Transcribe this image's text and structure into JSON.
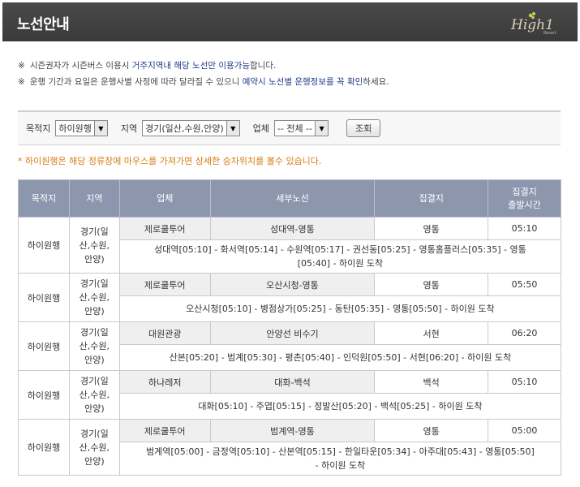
{
  "header": {
    "title": "노선안내",
    "logo_text": "High1"
  },
  "notes": [
    {
      "mark": "※",
      "pre": "시즌권자가 시즌버스 이용시 ",
      "highlight": "거주지역내 해당 노선만 이용가능",
      "post": "합니다."
    },
    {
      "mark": "※",
      "pre": "운행 기간과 요일은 운행사별 사정에 따라 달라질 수 있으니 ",
      "highlight": "예약시 노선별 운행정보를 꼭 확인",
      "post": "하세요."
    }
  ],
  "filter": {
    "destination_label": "목적지",
    "destination_value": "하이원행",
    "region_label": "지역",
    "region_value": "경기(일산,수원,안양)",
    "company_label": "업체",
    "company_value": "-- 전체 --",
    "search_button": "조회"
  },
  "hint": "* 하이원행은 해당 정류장에 마우스를 가져가면 상세한 승차위치를 볼수 있습니다.",
  "table": {
    "headers": {
      "destination": "목적지",
      "region": "지역",
      "company": "업체",
      "route": "세부노선",
      "hub": "집결지",
      "time_line1": "집결지",
      "time_line2": "출발시간"
    },
    "rows": [
      {
        "destination": "하이원행",
        "region": [
          "경기(일",
          "산,수원,",
          "안양)"
        ],
        "company": "제로쿨투어",
        "route": "성대역-영통",
        "hub": "영통",
        "time": "05:10",
        "stops": [
          "성대역[05:10] - 화서역[05:14] - 수원역[05:17] - 권선동[05:25] - 영통홈플러스[05:35] - 영통",
          "[05:40] - 하이원 도착"
        ]
      },
      {
        "destination": "하이원행",
        "region": [
          "경기(일",
          "산,수원,",
          "안양)"
        ],
        "company": "제로쿨투어",
        "route": "오산시청-영통",
        "hub": "영통",
        "time": "05:50",
        "stops": [
          "오산시청[05:10] - 병점상가[05:25] - 동탄[05:35] - 영통[05:50] - 하이원 도착"
        ]
      },
      {
        "destination": "하이원행",
        "region": [
          "경기(일",
          "산,수원,",
          "안양)"
        ],
        "company": "대원관광",
        "route": "안양선 비수기",
        "hub": "서현",
        "time": "06:20",
        "stops": [
          "산본[05:20] - 범계[05:30] - 평촌[05:40] - 인덕원[05:50] - 서현[06:20] - 하이원 도착"
        ]
      },
      {
        "destination": "하이원행",
        "region": [
          "경기(일",
          "산,수원,",
          "안양)"
        ],
        "company": "하나레저",
        "route": "대화-백석",
        "hub": "백석",
        "time": "05:10",
        "stops": [
          "대화[05:10] - 주엽[05:15] - 정발산[05:20] - 백석[05:25] - 하이원 도착"
        ]
      },
      {
        "destination": "하이원행",
        "region": [
          "경기(일",
          "산,수원,",
          "안양)"
        ],
        "company": "제로쿨투어",
        "route": "범계역-영통",
        "hub": "영통",
        "time": "05:00",
        "stops": [
          "범계역[05:00] - 금정역[05:10] - 산본역[05:15] - 한일타운[05:34] - 아주대[05:43] - 영통[05:50]",
          "- 하이원 도착"
        ]
      }
    ]
  },
  "colors": {
    "header_bg": "#3f3f3f",
    "table_header_bg": "#8c97ae",
    "hint": "#d97a12",
    "highlight": "#223c8a"
  }
}
